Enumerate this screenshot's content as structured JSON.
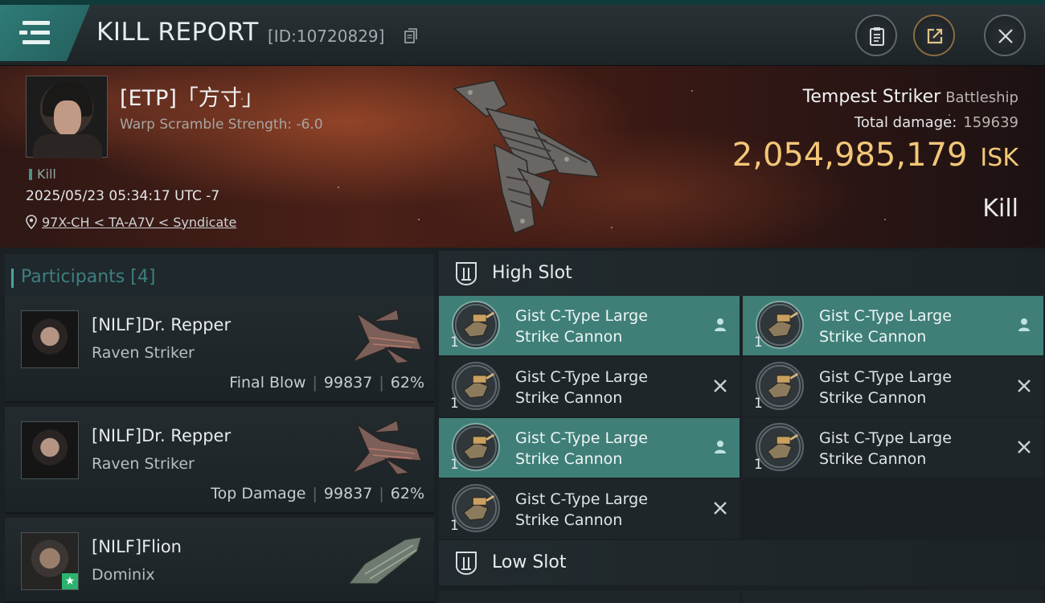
{
  "header": {
    "title": "KILL REPORT",
    "report_id": "[ID:10720829]",
    "menu_icon": "hamburger-menu-icon",
    "clipboard_icon": "clipboard-icon",
    "share_icon": "share-icon",
    "close_icon": "close-icon"
  },
  "victim": {
    "name": "[ETP]「方寸」",
    "warp_scramble": "Warp Scramble Strength: -6.0",
    "tag": "Kill",
    "datetime": "2025/05/23 05:34:17 UTC -7",
    "location": "97X-CH < TA-A7V < Syndicate",
    "ship_name": "Tempest Striker",
    "ship_class": "Battleship",
    "total_damage_label": "Total damage:",
    "total_damage": "159639",
    "isk_value": "2,054,985,179",
    "isk_unit": "ISK",
    "result": "Kill"
  },
  "participants": {
    "label": "Participants",
    "count": "[4]",
    "rows": [
      {
        "name": "[NILF]Dr. Repper",
        "ship": "Raven Striker",
        "role": "Final Blow",
        "damage": "99837",
        "percent": "62%"
      },
      {
        "name": "[NILF]Dr. Repper",
        "ship": "Raven Striker",
        "role": "Top Damage",
        "damage": "99837",
        "percent": "62%"
      },
      {
        "name": "[NILF]Flion",
        "ship": "Dominix",
        "role": "",
        "damage": "",
        "percent": ""
      }
    ]
  },
  "fittings": {
    "high_slot_label": "High Slot",
    "low_slot_label": "Low Slot",
    "high_slot": [
      {
        "line1": "Gist C-Type Large",
        "line2": "Strike Cannon",
        "qty": "1",
        "status": "person-icon",
        "active": true
      },
      {
        "line1": "Gist C-Type Large",
        "line2": "Strike Cannon",
        "qty": "1",
        "status": "person-icon",
        "active": true
      },
      {
        "line1": "Gist C-Type Large",
        "line2": "Strike Cannon",
        "qty": "1",
        "status": "destroyed-x-icon",
        "active": false
      },
      {
        "line1": "Gist C-Type Large",
        "line2": "Strike Cannon",
        "qty": "1",
        "status": "destroyed-x-icon",
        "active": false
      },
      {
        "line1": "Gist C-Type Large",
        "line2": "Strike Cannon",
        "qty": "1",
        "status": "person-icon",
        "active": true
      },
      {
        "line1": "Gist C-Type Large",
        "line2": "Strike Cannon",
        "qty": "1",
        "status": "destroyed-x-icon",
        "active": false
      },
      {
        "line1": "Gist C-Type Large",
        "line2": "Strike Cannon",
        "qty": "1",
        "status": "destroyed-x-icon",
        "active": false
      }
    ]
  },
  "colors": {
    "accent_teal": "#3f7f78",
    "isk_gold": "#f3c778",
    "participants_label": "#3f7f80"
  }
}
